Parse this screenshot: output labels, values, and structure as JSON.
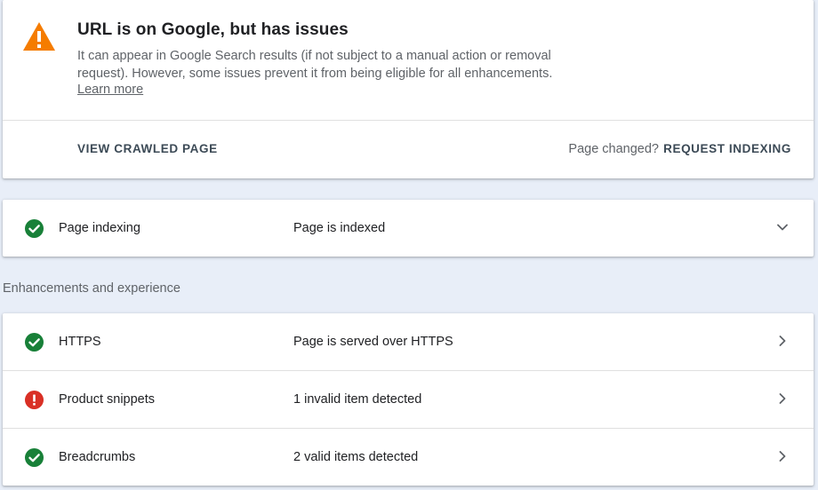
{
  "status": {
    "title": "URL is on Google, but has issues",
    "description": "It can appear in Google Search results (if not subject to a manual action or removal request). However, some issues prevent it from being eligible for all enhancements.",
    "learn_more": "Learn more",
    "icon": "warning-triangle-icon",
    "icon_color": "#f57c00",
    "view_crawled_label": "VIEW CRAWLED PAGE",
    "page_changed_label": "Page changed?",
    "request_indexing_label": "REQUEST INDEXING"
  },
  "indexing": {
    "label": "Page indexing",
    "value": "Page is indexed",
    "icon": "check-circle-icon",
    "icon_color": "#188038",
    "chevron": "chevron-down-icon"
  },
  "enhancements": {
    "section_title": "Enhancements and experience",
    "items": [
      {
        "label": "HTTPS",
        "value": "Page is served over HTTPS",
        "icon": "check-circle-icon",
        "icon_color": "#188038"
      },
      {
        "label": "Product snippets",
        "value": "1 invalid item detected",
        "icon": "error-circle-icon",
        "icon_color": "#d93025"
      },
      {
        "label": "Breadcrumbs",
        "value": "2 valid items detected",
        "icon": "check-circle-icon",
        "icon_color": "#188038"
      }
    ]
  }
}
